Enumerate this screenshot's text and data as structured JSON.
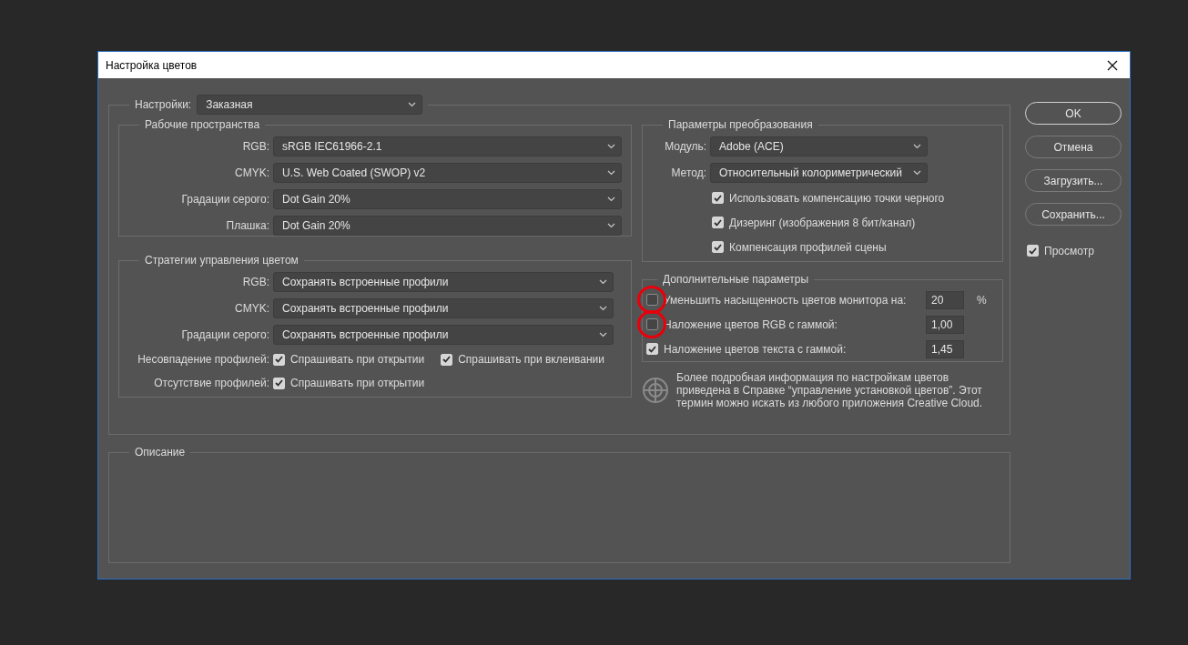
{
  "window": {
    "title": "Настройка цветов"
  },
  "settings": {
    "label": "Настройки:",
    "value": "Заказная"
  },
  "working_spaces": {
    "title": "Рабочие пространства",
    "rows": [
      {
        "label": "RGB:",
        "value": "sRGB IEC61966-2.1"
      },
      {
        "label": "CMYK:",
        "value": "U.S. Web Coated (SWOP) v2"
      },
      {
        "label": "Градации серого:",
        "value": "Dot Gain 20%"
      },
      {
        "label": "Плашка:",
        "value": "Dot Gain 20%"
      }
    ]
  },
  "policies": {
    "title": "Стратегии управления цветом",
    "rows": [
      {
        "label": "RGB:",
        "value": "Сохранять встроенные профили"
      },
      {
        "label": "CMYK:",
        "value": "Сохранять встроенные профили"
      },
      {
        "label": "Градации серого:",
        "value": "Сохранять встроенные профили"
      }
    ],
    "options": [
      {
        "label": "Несовпадение профилей:",
        "checks": [
          {
            "label": "Спрашивать при открытии",
            "checked": true
          },
          {
            "label": "Спрашивать при вклеивании",
            "checked": true
          }
        ]
      },
      {
        "label": "Отсутствие профилей:",
        "checks": [
          {
            "label": "Спрашивать при открытии",
            "checked": true
          }
        ]
      }
    ]
  },
  "conversion": {
    "title": "Параметры преобразования",
    "rows": [
      {
        "label": "Модуль:",
        "value": "Adobe (ACE)"
      },
      {
        "label": "Метод:",
        "value": "Относительный колориметрический"
      }
    ],
    "checks": [
      {
        "label": "Использовать компенсацию точки черного",
        "checked": true
      },
      {
        "label": "Дизеринг (изображения 8 бит/канал)",
        "checked": true
      },
      {
        "label": "Компенсация профилей сцены",
        "checked": true
      }
    ]
  },
  "advanced": {
    "title": "Дополнительные параметры",
    "rows": [
      {
        "label": "Уменьшить насыщенность цветов монитора на:",
        "checked": false,
        "circled": true,
        "value": "20",
        "unit": "%"
      },
      {
        "label": "Наложение цветов RGB с гаммой:",
        "checked": false,
        "circled": true,
        "value": "1,00"
      },
      {
        "label": "Наложение цветов текста с гаммой:",
        "checked": true,
        "circled": false,
        "value": "1,45"
      }
    ]
  },
  "info": "Более подробная информация по настройкам цветов приведена в Справке “управление установкой цветов”. Этот термин можно искать из любого приложения Creative Cloud.",
  "description": {
    "title": "Описание"
  },
  "buttons": [
    {
      "label": "OK",
      "default": true
    },
    {
      "label": "Отмена",
      "default": false
    },
    {
      "label": "Загрузить...",
      "default": false
    },
    {
      "label": "Сохранить...",
      "default": false
    }
  ],
  "preview": {
    "label": "Просмотр",
    "checked": true
  }
}
